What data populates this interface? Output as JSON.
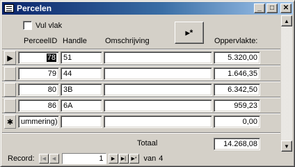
{
  "window": {
    "title": "Percelen"
  },
  "form": {
    "checkbox_label": "Vul vlak",
    "new_record_button": "▸*",
    "headers": {
      "perceel_id": "PerceelID",
      "handle": "Handle",
      "omschrijving": "Omschrijving",
      "oppervlakte": "Oppervlakte:"
    },
    "rows": [
      {
        "selector": "▶",
        "perceel_id": "78",
        "handle": "51",
        "omschrijving": "",
        "oppervlakte": "5.320,00"
      },
      {
        "selector": "",
        "perceel_id": "79",
        "handle": "44",
        "omschrijving": "",
        "oppervlakte": "1.646,35"
      },
      {
        "selector": "",
        "perceel_id": "80",
        "handle": "3B",
        "omschrijving": "",
        "oppervlakte": "6.342,50"
      },
      {
        "selector": "",
        "perceel_id": "86",
        "handle": "6A",
        "omschrijving": "",
        "oppervlakte": "959,23"
      },
      {
        "selector": "✱",
        "perceel_id": "ummering)",
        "handle": "",
        "omschrijving": "",
        "oppervlakte": "0,00"
      }
    ],
    "total_label": "Totaal",
    "total_value": "14.268,08"
  },
  "navigation": {
    "record_label": "Record:",
    "current": "1",
    "of_label": "van",
    "count": "4"
  }
}
